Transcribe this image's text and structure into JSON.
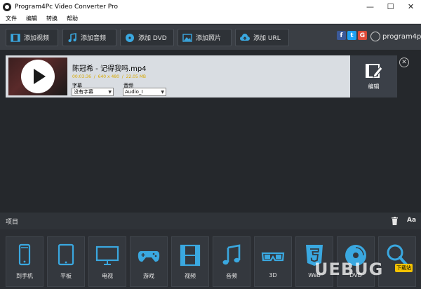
{
  "window": {
    "title": "Program4Pc Video Converter Pro",
    "min": "—",
    "max": "☐",
    "close": "✕"
  },
  "menu": [
    "文件",
    "编辑",
    "转换",
    "帮助"
  ],
  "toolbar": {
    "add_video": "添加视频",
    "add_audio": "添加音频",
    "add_dvd": "添加 DVD",
    "add_photo": "添加照片",
    "add_url": "添加 URL"
  },
  "social": {
    "facebook": "f",
    "twitter": "t",
    "google": "G"
  },
  "brand": "program4pc",
  "file": {
    "title": "陈冠希 - 记得我吗.mp4",
    "duration": "00:03:36",
    "sep1": "/",
    "resolution": "640 x 480",
    "sep2": "/",
    "size": "22.05 MB",
    "subtitle_label": "字幕",
    "subtitle_value": "没有字幕",
    "audio_label": "音频",
    "audio_value": "Audio_I",
    "edit_label": "编辑"
  },
  "project": {
    "label": "项目",
    "font_btn": "Aa"
  },
  "categories": [
    {
      "label": "到手机",
      "icon": "phone-icon"
    },
    {
      "label": "平板",
      "icon": "tablet-icon"
    },
    {
      "label": "电视",
      "icon": "tv-icon"
    },
    {
      "label": "游戏",
      "icon": "gamepad-icon"
    },
    {
      "label": "视频",
      "icon": "film-icon"
    },
    {
      "label": "音频",
      "icon": "music-icon"
    },
    {
      "label": "3D",
      "icon": "3d-glasses-icon"
    },
    {
      "label": "Web",
      "icon": "html5-icon"
    },
    {
      "label": "DVD",
      "icon": "disc-icon"
    },
    {
      "label": "",
      "icon": "search-icon"
    }
  ],
  "watermark": {
    "text": "UEBUG",
    "tag": "下载站"
  },
  "colors": {
    "accent": "#3aa8e0",
    "meta": "#d7a800",
    "toolbar": "#3a3e44",
    "row": "#d9dde2"
  }
}
